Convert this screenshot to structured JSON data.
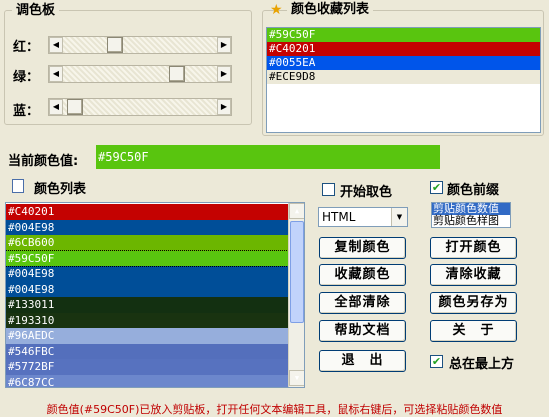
{
  "palette": {
    "title": "调色板",
    "sliders": [
      {
        "label": "红：",
        "value": 0.32
      },
      {
        "label": "绿：",
        "value": 0.77
      },
      {
        "label": "蓝：",
        "value": 0.03
      }
    ]
  },
  "favorites": {
    "title": "颜色收藏列表",
    "icon": "star-icon",
    "items": [
      {
        "text": "#59C50F",
        "color": "#59c50f",
        "fg": "#ffffff"
      },
      {
        "text": "#C40201",
        "color": "#c40201",
        "fg": "#ffffff"
      },
      {
        "text": "#0055EA",
        "color": "#0055ea",
        "fg": "#ffffff"
      },
      {
        "text": "#ECE9D8",
        "color": "#ece9d8",
        "fg": "#000000"
      }
    ]
  },
  "current": {
    "label": "当前颜色值:",
    "value": "#59C50F",
    "color": "#59c50f"
  },
  "color_list": {
    "title": "颜色列表",
    "icon": "document-icon",
    "items": [
      {
        "text": "#C40201",
        "color": "#c40201"
      },
      {
        "text": "#004E98",
        "color": "#004e98"
      },
      {
        "text": "#6CB600",
        "color": "#6cb600"
      },
      {
        "text": "#59C50F",
        "color": "#59c50f"
      },
      {
        "text": "#004E98",
        "color": "#004e98"
      },
      {
        "text": "#004E98",
        "color": "#004e98"
      },
      {
        "text": "#133011",
        "color": "#133011"
      },
      {
        "text": "#193310",
        "color": "#193310"
      },
      {
        "text": "#96AEDC",
        "color": "#96aedc"
      },
      {
        "text": "#546FBC",
        "color": "#546fbc"
      },
      {
        "text": "#5772BF",
        "color": "#5772bf"
      },
      {
        "text": "#6C87CC",
        "color": "#6c87cc"
      }
    ]
  },
  "options": {
    "start_pick": "开始取色",
    "start_pick_checked": false,
    "prefix": "颜色前缀",
    "prefix_checked": true,
    "format_value": "HTML",
    "clip_options": [
      "剪贴颜色数值",
      "剪贴颜色样图"
    ],
    "always_on_top": "总在最上方",
    "always_on_top_checked": true
  },
  "buttons": {
    "copy": "复制颜色",
    "open": "打开颜色",
    "collect": "收藏颜色",
    "clear_collect": "清除收藏",
    "clear_all": "全部清除",
    "save_as": "颜色另存为",
    "help": "帮助文档",
    "about": "关　于",
    "exit": "退　出"
  },
  "status": {
    "message": "颜色值(#59C50F)已放入剪贴板，打开任何文本编辑工具，鼠标右键后，可选择粘贴颜色数值"
  }
}
